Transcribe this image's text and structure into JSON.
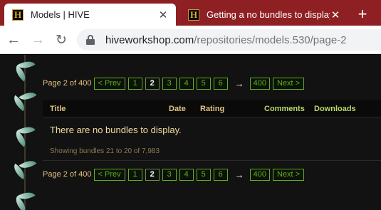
{
  "browser": {
    "tabs": [
      {
        "title": "Models | HIVE",
        "favicon_letter": "H",
        "active": true
      },
      {
        "title": "Getting a no bundles to display.",
        "favicon_letter": "H",
        "active": false
      }
    ],
    "new_tab_symbol": "+",
    "close_symbol": "✕",
    "url_host": "hiveworkshop.com",
    "url_path": "/repositories/models.530/page-2"
  },
  "pager_top": {
    "label": "Page 2 of 400",
    "prev": "< Prev",
    "pages": [
      "1",
      "2",
      "3",
      "4",
      "5",
      "6"
    ],
    "current": "2",
    "arrow": "→",
    "last": "400",
    "next": "Next >"
  },
  "pager_bottom": {
    "label": "Page 2 of 400",
    "prev": "< Prev",
    "pages": [
      "1",
      "2",
      "3",
      "4",
      "5",
      "6"
    ],
    "current": "2",
    "arrow": "→",
    "last": "400",
    "next": "Next >"
  },
  "table": {
    "columns": {
      "title": "Title",
      "date": "Date",
      "rating": "Rating",
      "comments": "Comments",
      "downloads": "Downloads"
    },
    "empty_message": "There are no bundles to display.",
    "showing": "Showing bundles 21 to 20 of 7,983"
  },
  "colors": {
    "tabstrip": "#8e1f22",
    "pager_green": "#5fae1f",
    "gold_text": "#e2c47f"
  }
}
